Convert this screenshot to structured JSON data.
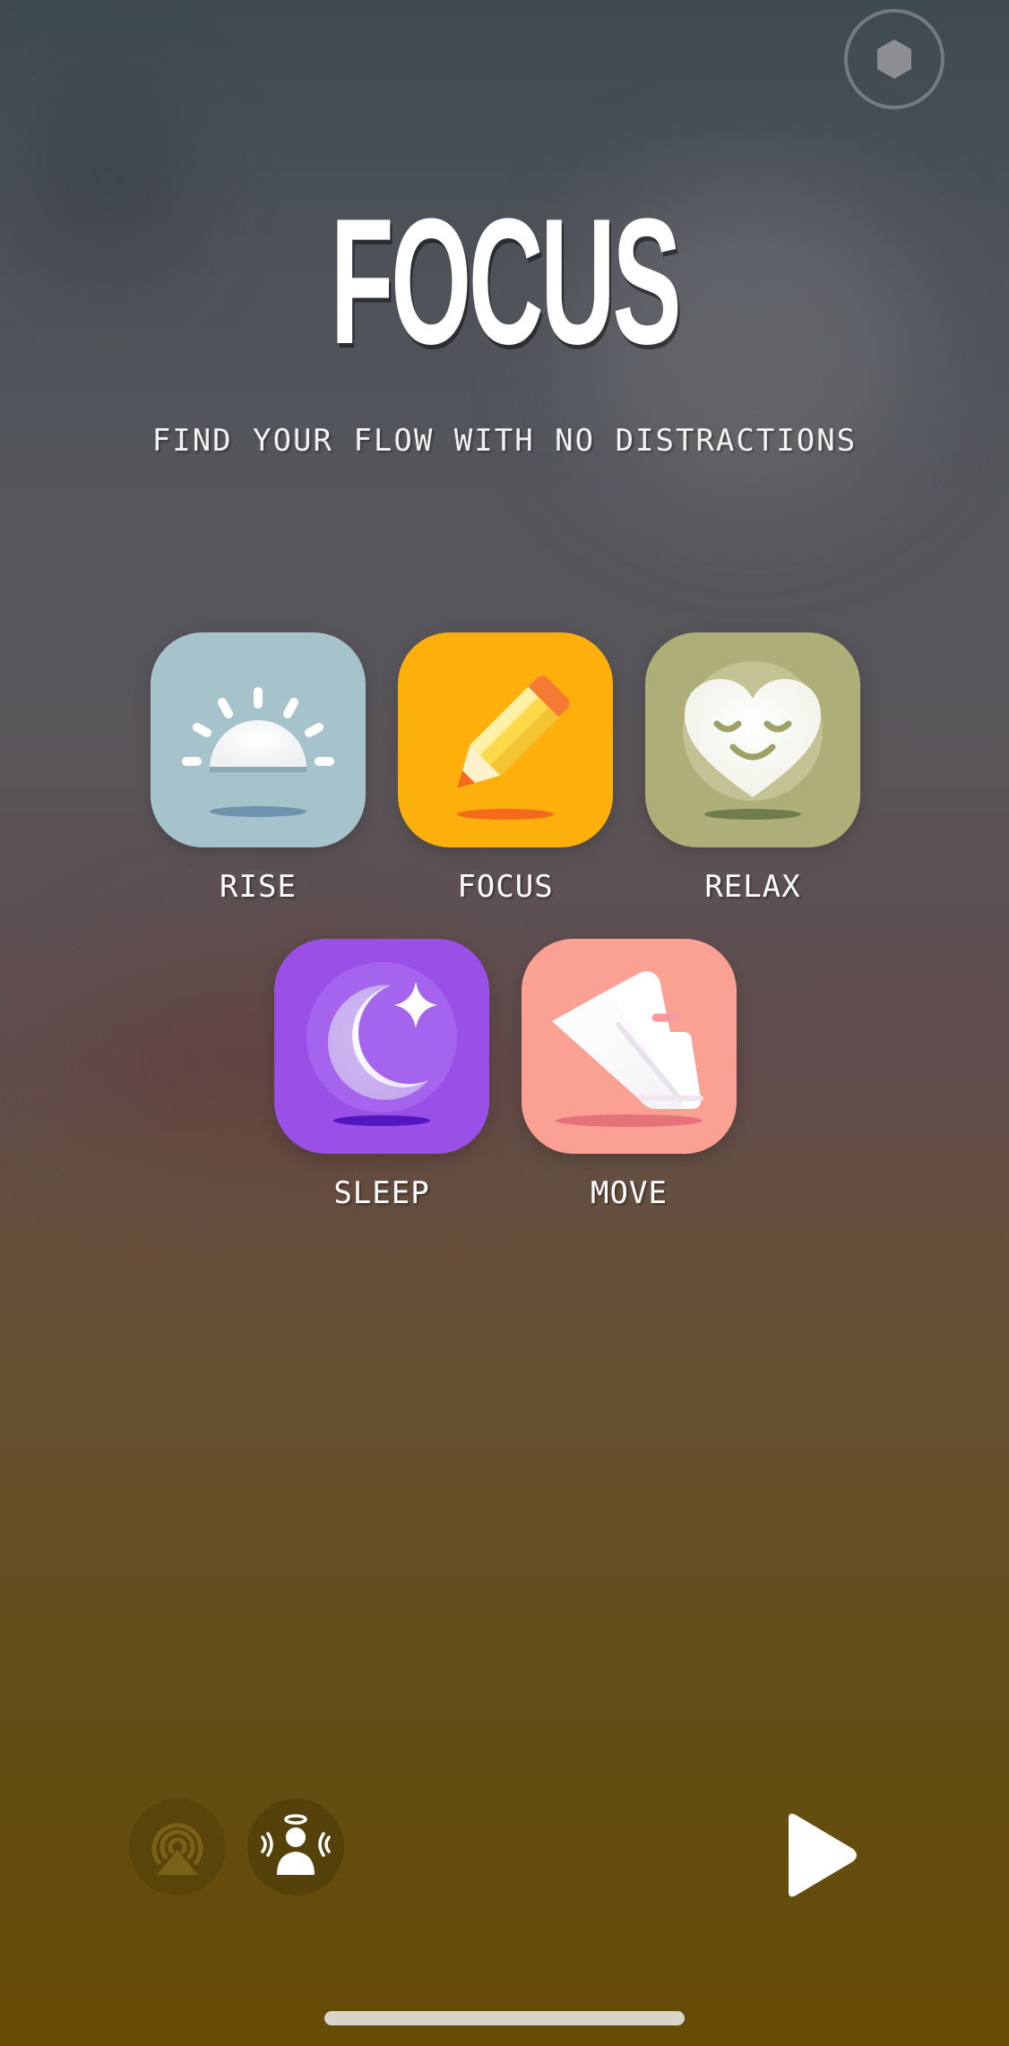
{
  "header": {
    "title": "FOCUS",
    "subtitle": "FIND YOUR FLOW WITH NO DISTRACTIONS",
    "profile_icon": "hexagon-icon"
  },
  "modes": [
    {
      "label": "RISE",
      "icon": "sunrise-icon",
      "color": "#a6c2ca",
      "selected": false
    },
    {
      "label": "FOCUS",
      "icon": "pencil-icon",
      "color": "#fdaf0b",
      "selected": true
    },
    {
      "label": "RELAX",
      "icon": "smile-heart-icon",
      "color": "#aeae78",
      "selected": false
    },
    {
      "label": "SLEEP",
      "icon": "moon-star-icon",
      "color": "#9a50e7",
      "selected": false
    },
    {
      "label": "MOVE",
      "icon": "sneaker-icon",
      "color": "#fba193",
      "selected": false
    }
  ],
  "controls": {
    "airplay_icon": "airplay-icon",
    "spatial_audio_icon": "spatial-audio-person-icon",
    "play_icon": "play-icon"
  }
}
